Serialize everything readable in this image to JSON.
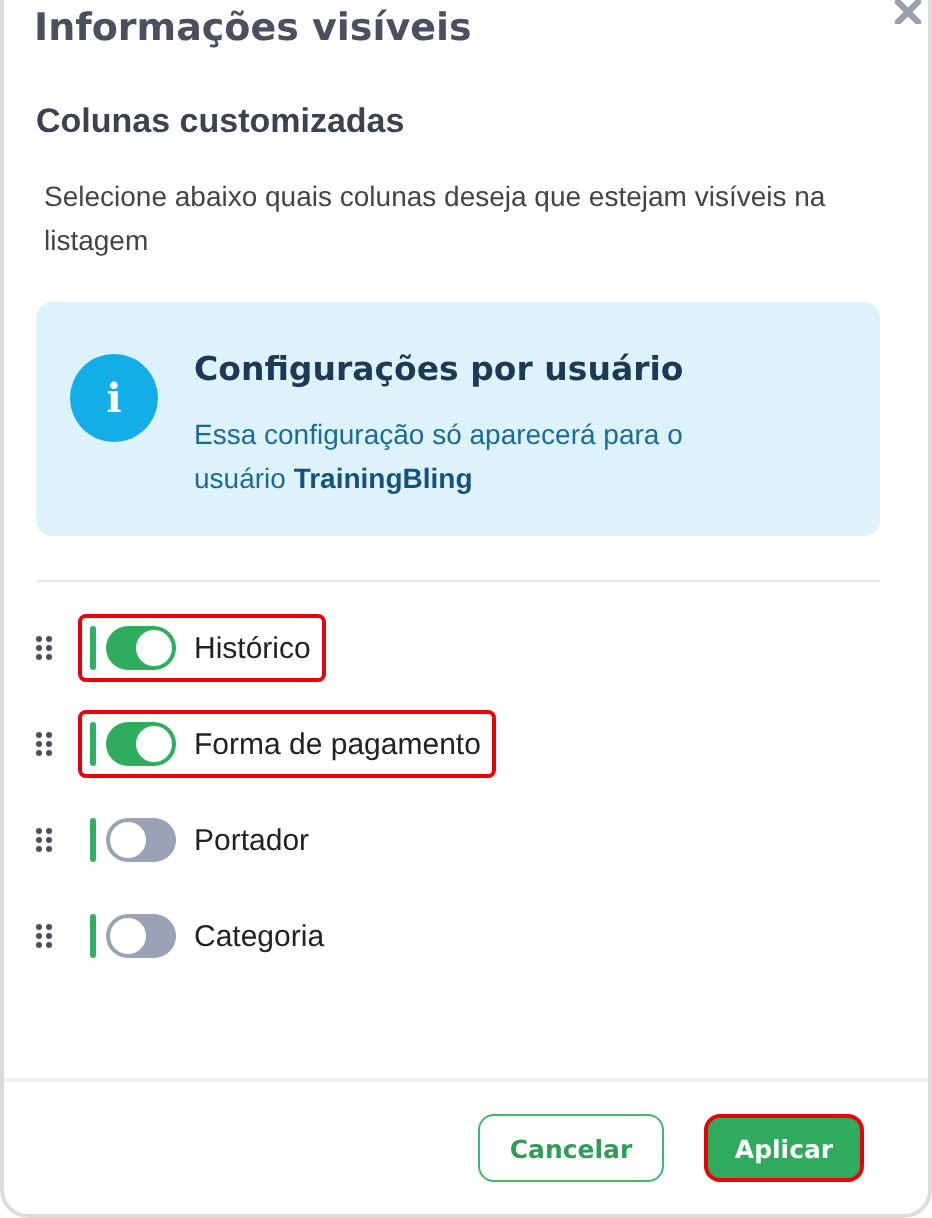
{
  "title": "Informações visíveis",
  "section_title": "Colunas customizadas",
  "description": "Selecione abaixo quais colunas deseja que estejam visíveis na listagem",
  "info": {
    "icon": "i",
    "title": "Configurações por usuário",
    "text": "Essa configuração só aparecerá para o usuário **TrainingBling**"
  },
  "columns": [
    {
      "label": "Histórico",
      "on": true,
      "highlighted": true
    },
    {
      "label": "Forma de pagamento",
      "on": true,
      "highlighted": true
    },
    {
      "label": "Portador",
      "on": false,
      "highlighted": false
    },
    {
      "label": "Categoria",
      "on": false,
      "highlighted": false
    }
  ],
  "buttons": [
    {
      "label": "Cancelar",
      "kind": "secondary",
      "highlighted": false
    },
    {
      "label": "Aplicar",
      "kind": "primary",
      "highlighted": true
    }
  ]
}
